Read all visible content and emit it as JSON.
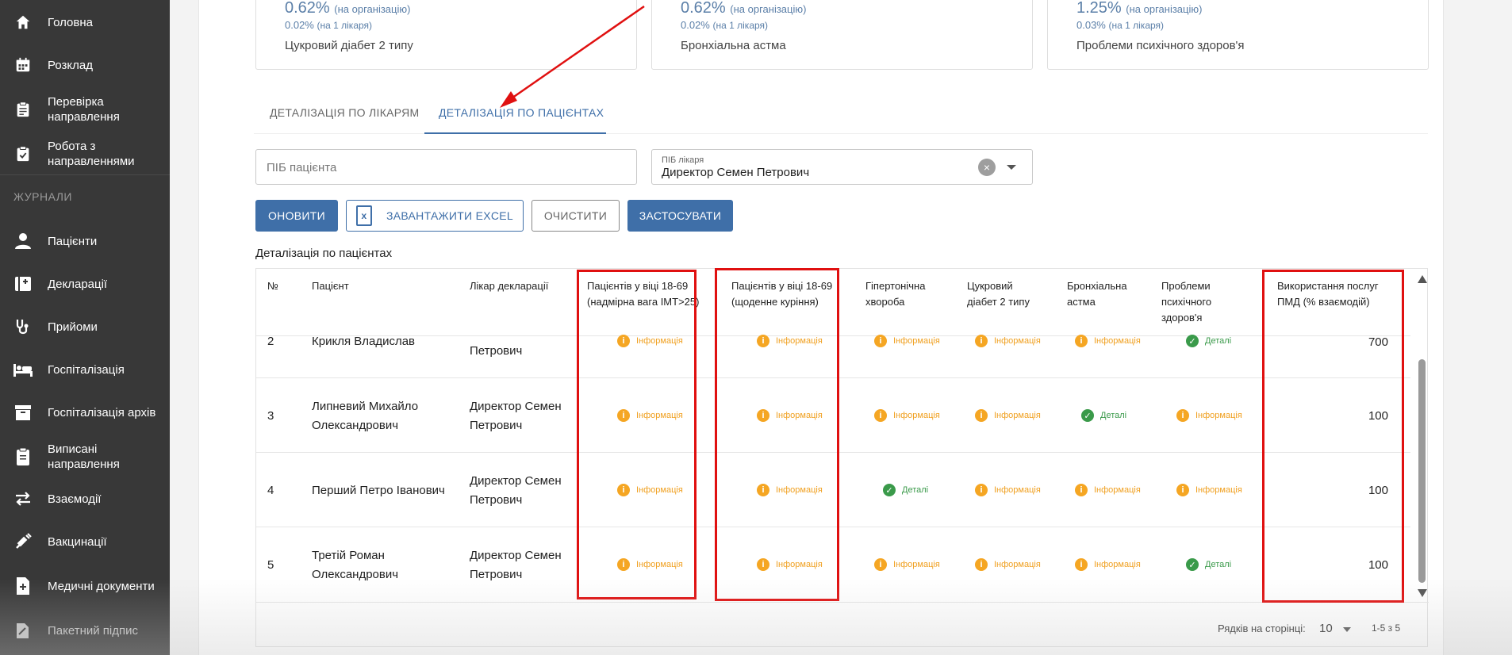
{
  "sidebar": {
    "items": [
      {
        "label": "Головна",
        "icon": "home-icon"
      },
      {
        "label": "Розклад",
        "icon": "calendar-icon"
      },
      {
        "label": "Перевірка направлення",
        "icon": "clipboard-icon"
      },
      {
        "label": "Робота з направленнями",
        "icon": "clipboard-check-icon"
      }
    ],
    "section": "ЖУРНАЛИ",
    "journal_items": [
      {
        "label": "Пацієнти",
        "icon": "person-icon"
      },
      {
        "label": "Декларації",
        "icon": "medical-plus-icon"
      },
      {
        "label": "Прийоми",
        "icon": "stethoscope-icon"
      },
      {
        "label": "Госпіталізація",
        "icon": "bed-icon"
      },
      {
        "label": "Госпіталізація архів",
        "icon": "archive-icon"
      },
      {
        "label": "Виписані направлення",
        "icon": "document-icon"
      },
      {
        "label": "Взаємодії",
        "icon": "exchange-icon"
      },
      {
        "label": "Вакцинації",
        "icon": "syringe-icon"
      },
      {
        "label": "Медичні документи",
        "icon": "medical-doc-icon"
      },
      {
        "label": "Пакетний підпис",
        "icon": "signature-icon"
      }
    ]
  },
  "cards": [
    {
      "pct": "0.62%",
      "pct_note": "(на організацію)",
      "sub": "0.02%",
      "sub_note": "(на 1 лікаря)",
      "name": "Цукровий діабет 2 типу"
    },
    {
      "pct": "0.62%",
      "pct_note": "(на організацію)",
      "sub": "0.02%",
      "sub_note": "(на 1 лікаря)",
      "name": "Бронхіальна астма"
    },
    {
      "pct": "1.25%",
      "pct_note": "(на організацію)",
      "sub": "0.03%",
      "sub_note": "(на 1 лікаря)",
      "name": "Проблеми психічного здоров'я"
    }
  ],
  "tabs": {
    "doctors": "ДЕТАЛІЗАЦІЯ ПО ЛІКАРЯМ",
    "patients": "ДЕТАЛІЗАЦІЯ ПО ПАЦІЄНТАХ"
  },
  "filters": {
    "patient_placeholder": "ПІБ пацієнта",
    "doctor_label": "ПІБ лікаря",
    "doctor_value": "Директор Семен Петрович"
  },
  "buttons": {
    "refresh": "ОНОВИТИ",
    "excel": "ЗАВАНТАЖИТИ EXCEL",
    "clear": "ОЧИСТИТИ",
    "apply": "ЗАСТОСУВАТИ"
  },
  "section_title": "Деталізація по пацієнтах",
  "table": {
    "headers": {
      "num": "№",
      "patient": "Пацієнт",
      "doctor": "Лікар декларації",
      "overweight": "Пацієнтів у віці 18-69 (надмірна вага ІМТ>25)",
      "smoking": "Пацієнтів у віці 18-69 (щоденне куріння)",
      "hypertension": "Гіпертонічна хвороба",
      "diabetes": "Цукровий діабет 2 типу",
      "asthma": "Бронхіальна астма",
      "mental": "Проблеми психічного здоров'я",
      "pmd": "Використання послуг ПМД (% взаємодій)"
    },
    "rows": [
      {
        "num": "2",
        "patient": "Крикля Владислав",
        "doctor": "Петрович",
        "cells": [
          "Інформація",
          "Інформація",
          "Інформація",
          "Інформація",
          "Інформація",
          "Деталі"
        ],
        "pmd": "700"
      },
      {
        "num": "3",
        "patient": "Липневий Михайло Олександрович",
        "doctor": "Директор Семен Петрович",
        "cells": [
          "Інформація",
          "Інформація",
          "Інформація",
          "Інформація",
          "Деталі",
          "Інформація"
        ],
        "pmd": "100"
      },
      {
        "num": "4",
        "patient": "Перший Петро Іванович",
        "doctor": "Директор Семен Петрович",
        "cells": [
          "Інформація",
          "Інформація",
          "Деталі",
          "Інформація",
          "Інформація",
          "Інформація"
        ],
        "pmd": "100"
      },
      {
        "num": "5",
        "patient": "Третій  Роман Олександрович",
        "doctor": "Директор Семен Петрович",
        "cells": [
          "Інформація",
          "Інформація",
          "Інформація",
          "Інформація",
          "Інформація",
          "Деталі"
        ],
        "pmd": "100"
      }
    ]
  },
  "pagination": {
    "rows_label": "Рядків на сторінці:",
    "rows_value": "10",
    "range": "1-5 з 5"
  },
  "colors": {
    "primary": "#3f6fa8",
    "info": "#f5a623",
    "ok": "#3a9a4a",
    "highlight": "#e01010",
    "sidebar": "#383838"
  }
}
